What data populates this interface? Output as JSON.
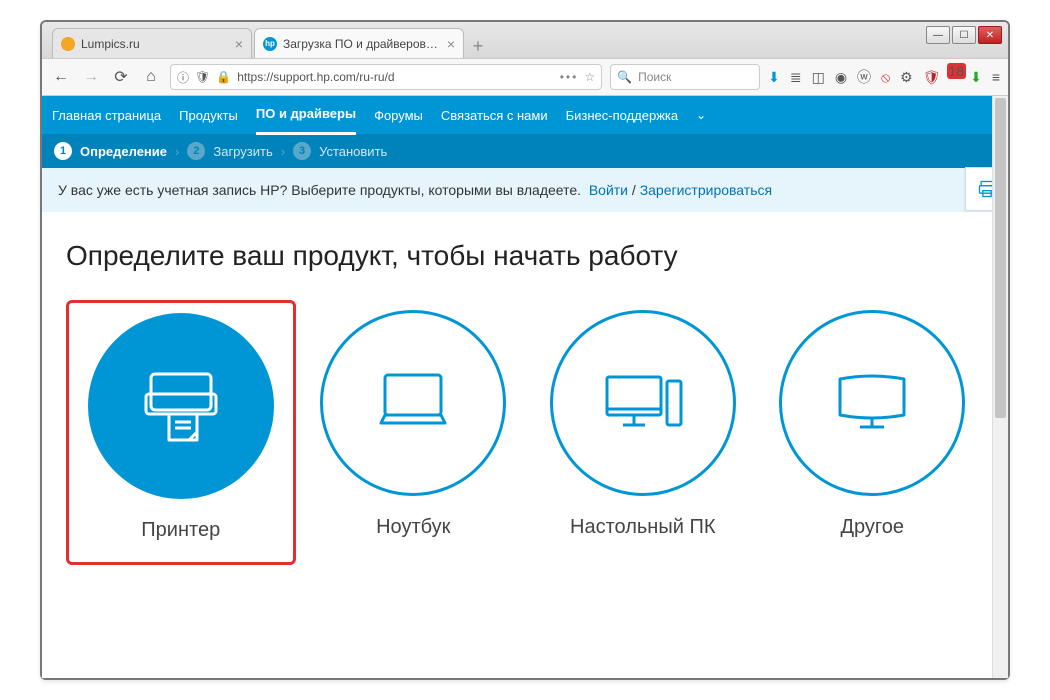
{
  "browser": {
    "tabs": [
      {
        "title": "Lumpics.ru",
        "favicon": "orange"
      },
      {
        "title": "Загрузка ПО и драйверов HP ",
        "favicon": "hp"
      }
    ],
    "url_display": "https://support.hp.com/ru-ru/d",
    "search_placeholder": "Поиск",
    "toolbar_badge": "18"
  },
  "hpnav": {
    "items": [
      "Главная страница",
      "Продукты",
      "ПО и драйверы",
      "Форумы",
      "Связаться с нами",
      "Бизнес-поддержка"
    ],
    "active_index": 2
  },
  "steps": {
    "s1": "Определение",
    "s2": "Загрузить",
    "s3": "Установить"
  },
  "banner": {
    "text": "У вас уже есть учетная запись HP? Выберите продукты, которыми вы владеете.",
    "login": "Войти",
    "sep": "/",
    "register": "Зарегистрироваться"
  },
  "main": {
    "heading": "Определите ваш продукт, чтобы начать работу",
    "cards": {
      "printer": "Принтер",
      "laptop": "Ноутбук",
      "desktop": "Настольный ПК",
      "other": "Другое"
    }
  }
}
